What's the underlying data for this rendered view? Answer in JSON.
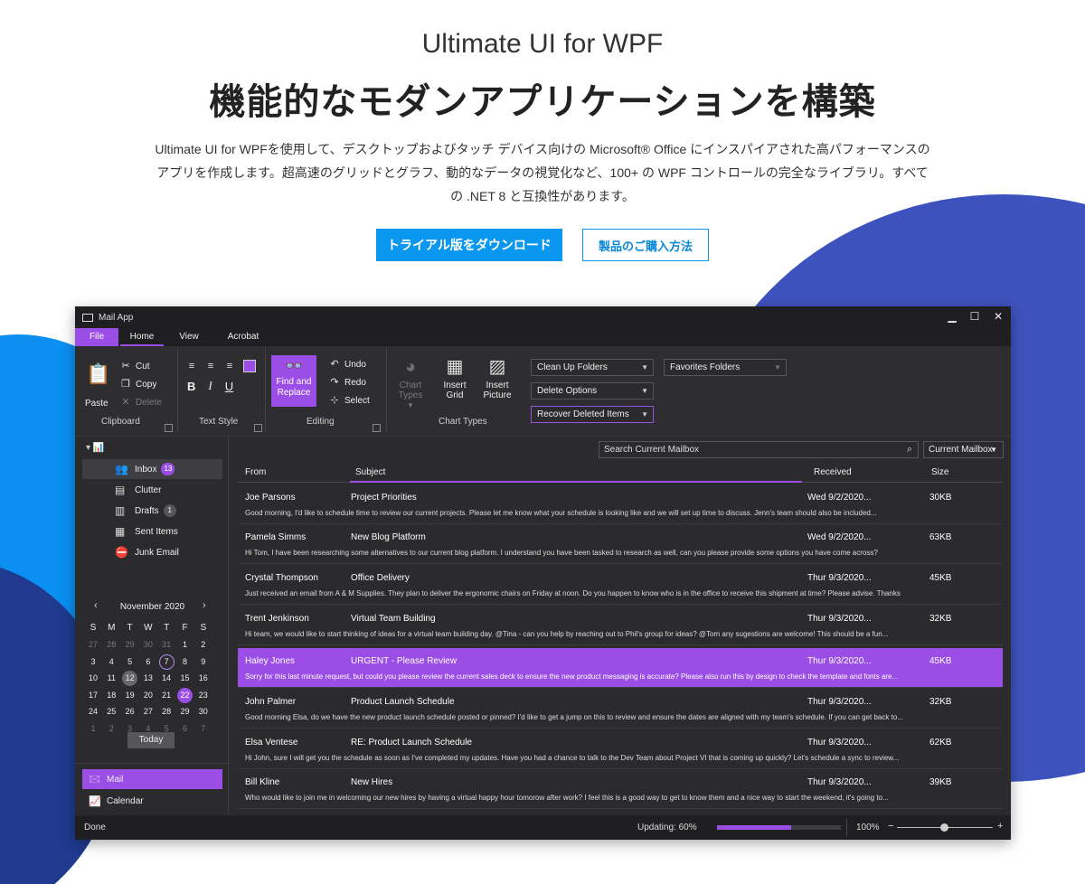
{
  "hero": {
    "subtitle": "Ultimate UI for WPF",
    "title": "機能的なモダンアプリケーションを構築",
    "description": "Ultimate UI for WPFを使用して、デスクトップおよびタッチ デバイス向けの Microsoft® Office にインスパイアされた高パフォーマンスのアプリを作成します。超高速のグリッドとグラフ、動的なデータの視覚化など、100+ の WPF コントロールの完全なライブラリ。すべての .NET 8 と互換性があります。",
    "primary_button": "トライアル版をダウンロード",
    "secondary_button": "製品のご購入方法"
  },
  "app": {
    "window_title": "Mail App",
    "controls": {
      "minimize": "▁",
      "maximize": "☐",
      "close": "✕"
    },
    "tabs": [
      "File",
      "Home",
      "View",
      "Acrobat"
    ],
    "ribbon": {
      "clipboard": {
        "paste": "Paste",
        "cut": "Cut",
        "copy": "Copy",
        "delete": "Delete",
        "label": "Clipboard"
      },
      "text_style": {
        "bold": "B",
        "italic": "I",
        "underline": "U",
        "label": "Text Style"
      },
      "editing": {
        "find_replace_1": "Find and",
        "find_replace_2": "Replace",
        "undo": "Undo",
        "redo": "Redo",
        "select": "Select",
        "label": "Editing"
      },
      "chart_types": {
        "chart_1": "Chart",
        "chart_2": "Types",
        "grid_1": "Insert",
        "grid_2": "Grid",
        "pic_1": "Insert",
        "pic_2": "Picture",
        "label": "Chart Types"
      },
      "combos": [
        "Clean Up Folders",
        "Delete Options",
        "Recover Deleted Items",
        "Favorites Folders"
      ]
    },
    "folders": [
      {
        "label": "Inbox",
        "badge": "13"
      },
      {
        "label": "Clutter"
      },
      {
        "label": "Drafts",
        "badge": "1"
      },
      {
        "label": "Sent Items"
      },
      {
        "label": "Junk Email"
      }
    ],
    "calendar": {
      "month": "November 2020",
      "prev": "‹",
      "next": "›",
      "dow": [
        "S",
        "M",
        "T",
        "W",
        "T",
        "F",
        "S"
      ],
      "weeks": [
        [
          "27",
          "28",
          "29",
          "30",
          "31",
          "1",
          "2"
        ],
        [
          "3",
          "4",
          "5",
          "6",
          "7",
          "8",
          "9"
        ],
        [
          "10",
          "11",
          "12",
          "13",
          "14",
          "15",
          "16"
        ],
        [
          "17",
          "18",
          "19",
          "20",
          "21",
          "22",
          "23"
        ],
        [
          "24",
          "25",
          "26",
          "27",
          "28",
          "29",
          "30"
        ],
        [
          "1",
          "2",
          "3",
          "4",
          "5",
          "6",
          "7"
        ]
      ],
      "today_button": "Today"
    },
    "nav": [
      {
        "label": "Mail"
      },
      {
        "label": "Calendar"
      }
    ],
    "search": {
      "placeholder": "Search Current Mailbox",
      "scope": "Current Mailbox"
    },
    "columns": {
      "from": "From",
      "subject": "Subject",
      "received": "Received",
      "size": "Size"
    },
    "emails": [
      {
        "from": "Joe Parsons",
        "subject": "Project Priorities",
        "received": "Wed 9/2/2020...",
        "size": "30KB",
        "preview": "Good morning, I'd like to schedule time to review our current projects. Please let me know what your schedule is looking like and we will set up time to discuss. Jenn's team should also be included..."
      },
      {
        "from": "Pamela Simms",
        "subject": "New Blog Platform",
        "received": "Wed 9/2/2020...",
        "size": "63KB",
        "preview": "Hi Tom, I have been researching some alternatives to our current blog platform.  I understand you have been tasked to research as well, can you please provide some options you have come across?"
      },
      {
        "from": "Crystal Thompson",
        "subject": "Office Delivery",
        "received": "Thur 9/3/2020...",
        "size": "45KB",
        "preview": "Just received an email from A & M Supplies.  They plan to deliver the ergonomic chairs on Friday at noon.  Do you happen to know who is in the office to receive this shipment at time? Please advise. Thanks"
      },
      {
        "from": "Trent Jenkinson",
        "subject": "Virtual Team Building",
        "received": "Thur 9/3/2020...",
        "size": "32KB",
        "preview": "Hi team, we would like to start thinking of ideas for a virtual team building day.  @Tina - can you help by reaching out to Phil's group for ideas? @Tom any sugestions are welcome! This should be a fun..."
      },
      {
        "from": "Haley Jones",
        "subject": "URGENT - Please Review",
        "received": "Thur 9/3/2020...",
        "size": "45KB",
        "preview": "Sorry for this last minute request, but could you please review the current sales deck to ensure the new product messaging is accurate?  Please also run this by design to check the template and fonts are..."
      },
      {
        "from": "John Palmer",
        "subject": "Product Launch Schedule",
        "received": "Thur 9/3/2020...",
        "size": "32KB",
        "preview": "Good morning Elsa, do we have the new product launch schedule posted or pinned? I'd like to get a jump on this to review and ensure the dates are aligned with my team's schedule. If you can get back to..."
      },
      {
        "from": "Elsa Ventese",
        "subject": "RE: Product Launch Schedule",
        "received": "Thur 9/3/2020...",
        "size": "62KB",
        "preview": "Hi John, sure I will get you the schedule as soon as I've completed my updates. Have you had a chance to talk to the Dev Team about Project VI that is coming up quickly?  Let's schedule a sync to review..."
      },
      {
        "from": "Bill Kline",
        "subject": "New Hires",
        "received": "Thur 9/3/2020...",
        "size": "39KB",
        "preview": "Who would like to join me in welcoming our new hires by having a virtual happy hour tomorow after work? I feel this is a good way to get to know them and a nice way to start the weekend, it's going to..."
      }
    ],
    "status": {
      "left": "Done",
      "updating": "Updating: 60%",
      "progress": 0.6,
      "zoom": "100%",
      "zoom_minus": "−",
      "zoom_plus": "+"
    }
  },
  "colors": {
    "accent_purple": "#9b4ee6",
    "hero_blue": "#0a97f0",
    "app_bg": "#2b2b2e"
  }
}
